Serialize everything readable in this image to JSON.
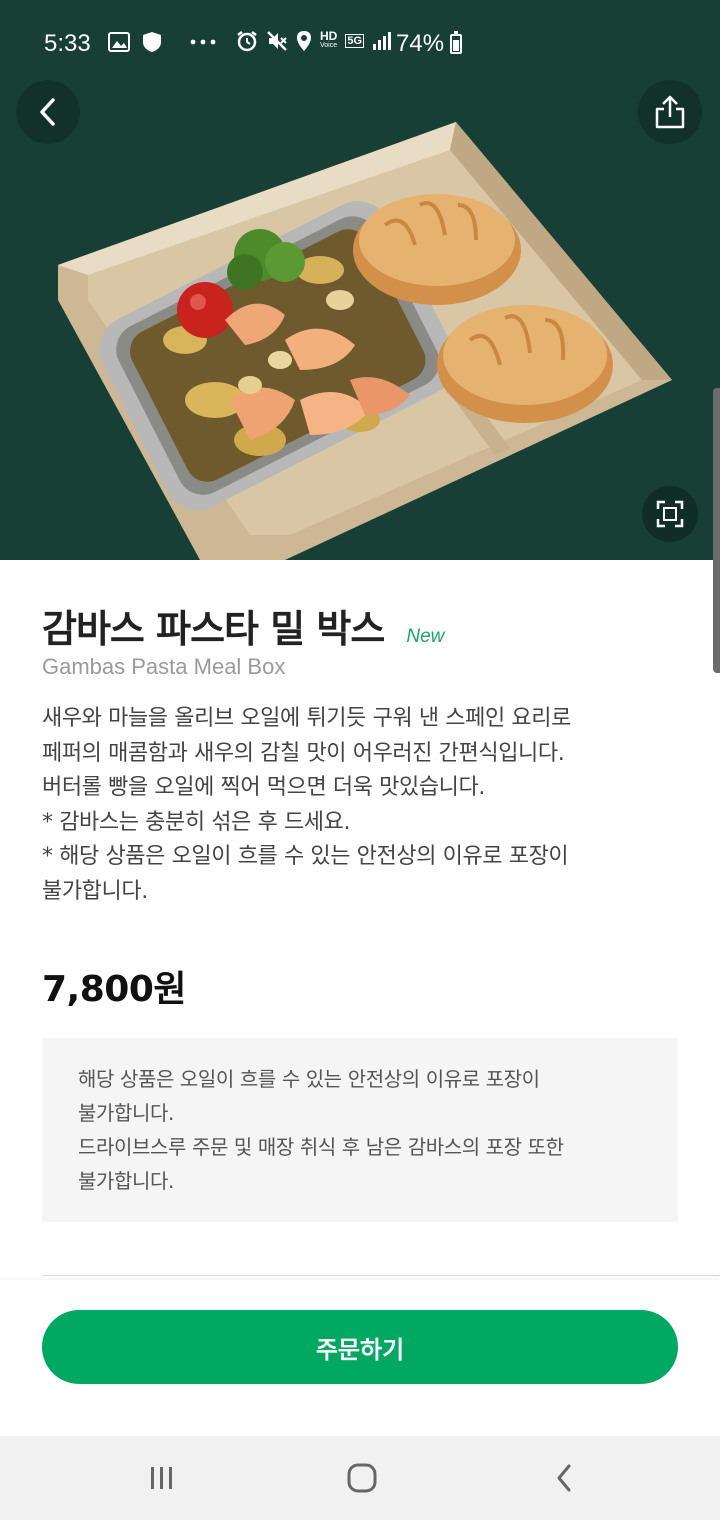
{
  "status_bar": {
    "time": "5:33",
    "network": "5G",
    "hd_label": "HD",
    "voice_label": "Voice",
    "battery": "74%"
  },
  "header": {
    "back_icon": "chevron-left-icon",
    "share_icon": "share-icon",
    "zoom_icon": "fullscreen-icon"
  },
  "product": {
    "name": "감바스 파스타 밀 박스",
    "badge": "New",
    "english_name": "Gambas Pasta Meal Box",
    "description_lines": [
      "새우와 마늘을 올리브 오일에 튀기듯 구워 낸 스페인 요리로",
      "페퍼의 매콤함과 새우의 감칠 맛이 어우러진 간편식입니다.",
      "버터롤 빵을 오일에 찍어 먹으면 더욱 맛있습니다.",
      "* 감바스는 충분히 섞은 후 드세요.",
      "* 해당 상품은 오일이 흐를 수 있는 안전상의 이유로 포장이",
      "불가합니다."
    ],
    "price": "7,800원"
  },
  "notice": {
    "lines": [
      "해당 상품은 오일이 흐를 수 있는 안전상의 이유로 포장이",
      "불가합니다.",
      "드라이브스루 주문 및 매장 취식 후 남은 감바스의 포장 또한",
      "불가합니다."
    ]
  },
  "actions": {
    "order_label": "주문하기"
  },
  "colors": {
    "hero_bg": "#173f36",
    "accent": "#00a862",
    "badge": "#1fa36b"
  }
}
